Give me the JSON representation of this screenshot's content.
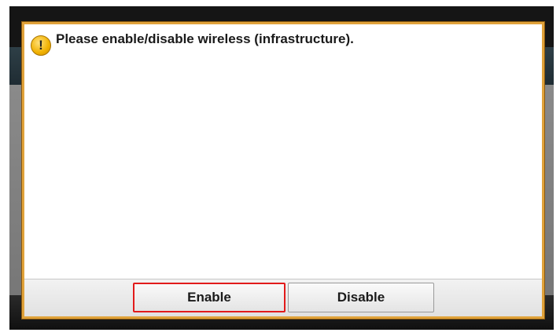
{
  "dialog": {
    "icon": "warning-icon",
    "icon_glyph": "!",
    "message": "Please enable/disable wireless (infrastructure).",
    "buttons": {
      "enable_label": "Enable",
      "disable_label": "Disable"
    }
  },
  "colors": {
    "dialog_border": "#e0a23a",
    "selected_button_border": "#e21b1b",
    "warning_icon": "#f1b100"
  }
}
